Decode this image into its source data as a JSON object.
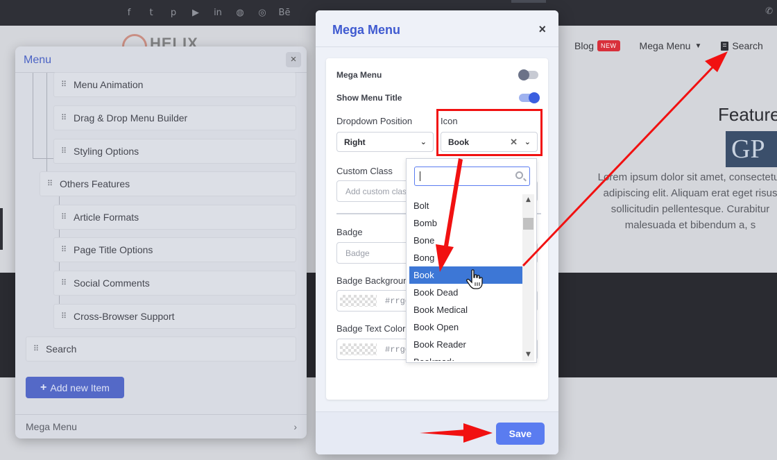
{
  "site": {
    "logo_text": "HELIX",
    "nav": {
      "blog": "Blog",
      "blog_badge": "NEW",
      "mega_menu": "Mega Menu",
      "search": "Search"
    },
    "feature_title": "Feature",
    "gp_text": "GP",
    "lorem": "Lorem ipsum dolor sit amet, consectetur adipiscing elit. Aliquam erat eget risus sollicitudin pellentesque. Curabitur malesuada et bibendum a, s"
  },
  "menu_panel": {
    "title": "Menu",
    "close": "×",
    "items": [
      {
        "label": "Menu Animation"
      },
      {
        "label": "Drag & Drop Menu Builder"
      },
      {
        "label": "Styling Options"
      },
      {
        "label": "Others Features"
      },
      {
        "label": "Article Formats"
      },
      {
        "label": "Page Title Options"
      },
      {
        "label": "Social Comments"
      },
      {
        "label": "Cross-Browser Support"
      },
      {
        "label": "Search"
      }
    ],
    "add_button": "Add new Item",
    "footer": "Mega Menu"
  },
  "modal": {
    "title": "Mega Menu",
    "close": "×",
    "mega_menu_label": "Mega Menu",
    "mega_menu_enabled": false,
    "show_title_label": "Show Menu Title",
    "show_title_enabled": true,
    "dropdown_position_label": "Dropdown Position",
    "dropdown_position_value": "Right",
    "icon_label": "Icon",
    "icon_value": "Book",
    "custom_class_label": "Custom Class",
    "custom_class_placeholder": "Add custom class",
    "badge_label": "Badge",
    "badge_placeholder": "Badge",
    "badge_bg_label": "Badge Background",
    "badge_bg_value": "#rrggbb",
    "badge_text_color_label": "Badge Text Color",
    "badge_text_color_value": "#rrggbb",
    "save": "Save"
  },
  "icon_dropdown": {
    "search_value": "",
    "options": [
      "Bolt",
      "Bomb",
      "Bone",
      "Bong",
      "Book",
      "Book Dead",
      "Book Medical",
      "Book Open",
      "Book Reader",
      "Bookmark"
    ],
    "selected": "Book"
  },
  "colors": {
    "accent": "#3f5ad0",
    "save_button": "#5a7cf0",
    "selected_option": "#3d77d6",
    "annotation_red": "#f11111",
    "new_badge": "#d8303b"
  }
}
